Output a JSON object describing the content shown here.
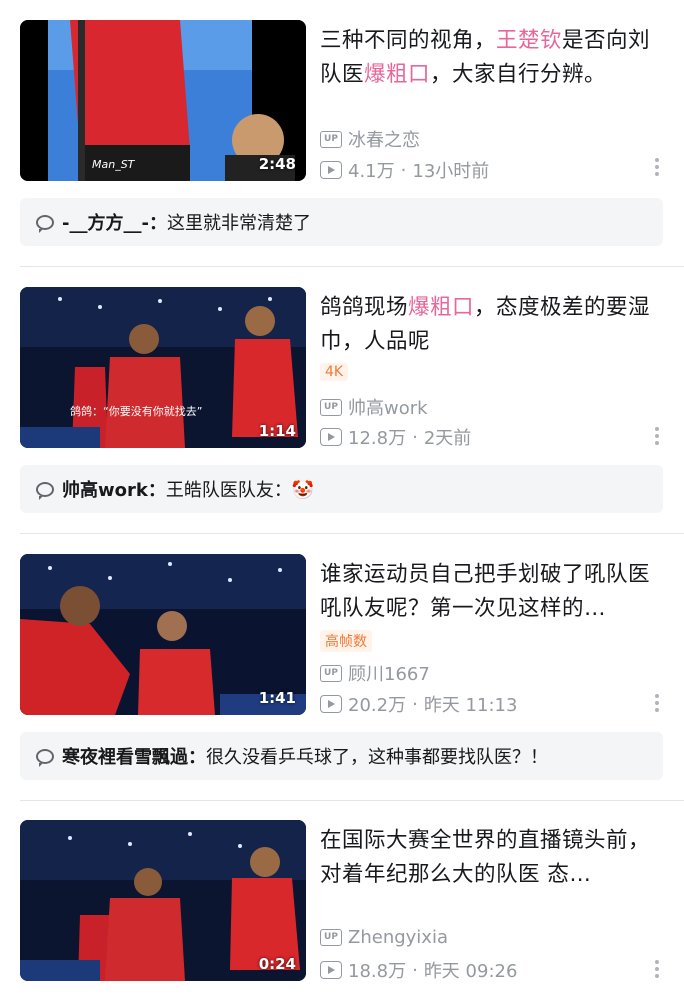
{
  "colors": {
    "highlight": "#e9669a",
    "meta": "#9499a0",
    "comment_bg": "#f4f5f7",
    "tag": "#f07a3a"
  },
  "videos": [
    {
      "title_parts": [
        {
          "text": "三种不同的视角，",
          "hl": false
        },
        {
          "text": "王楚钦",
          "hl": true
        },
        {
          "text": "是否向刘队医",
          "hl": false
        },
        {
          "text": "爆粗口",
          "hl": true
        },
        {
          "text": "，大家自行分辨。",
          "hl": false
        }
      ],
      "duration": "2:48",
      "thumb_caption": "Man_ST",
      "tag": "",
      "uploader": "冰春之恋",
      "views": "4.1万",
      "time": "13小时前",
      "up_label": "UP",
      "comment_user": "-__方方__-",
      "comment_text": "这里就非常清楚了"
    },
    {
      "title_parts": [
        {
          "text": "鸽鸽现场",
          "hl": false
        },
        {
          "text": "爆粗口",
          "hl": true
        },
        {
          "text": "，态度极差的要湿巾，人品呢",
          "hl": false
        }
      ],
      "duration": "1:14",
      "thumb_caption": "鸽鸽：“你要没有你就找去”",
      "tag": "4K",
      "uploader": "帅高work",
      "views": "12.8万",
      "time": "2天前",
      "up_label": "UP",
      "comment_user": "帅高work",
      "comment_text": "王皓队医队友：🤡"
    },
    {
      "title_parts": [
        {
          "text": "谁家运动员自己把手划破了吼队医吼队友呢？第一次见这样的…",
          "hl": false
        }
      ],
      "duration": "1:41",
      "thumb_caption": "",
      "tag": "高帧数",
      "uploader": "顾川1667",
      "views": "20.2万",
      "time": "昨天 11:13",
      "up_label": "UP",
      "comment_user": "寒夜裡看雪飄過",
      "comment_text": "很久没看乒乓球了，这种事都要找队医？！"
    },
    {
      "title_parts": [
        {
          "text": "在国际大赛全世界的直播镜头前，对着年纪那么大的队医 态…",
          "hl": false
        }
      ],
      "duration": "0:24",
      "thumb_caption": "",
      "tag": "",
      "uploader": "Zhengyixia",
      "views": "18.8万",
      "time": "昨天 09:26",
      "up_label": "UP"
    }
  ]
}
